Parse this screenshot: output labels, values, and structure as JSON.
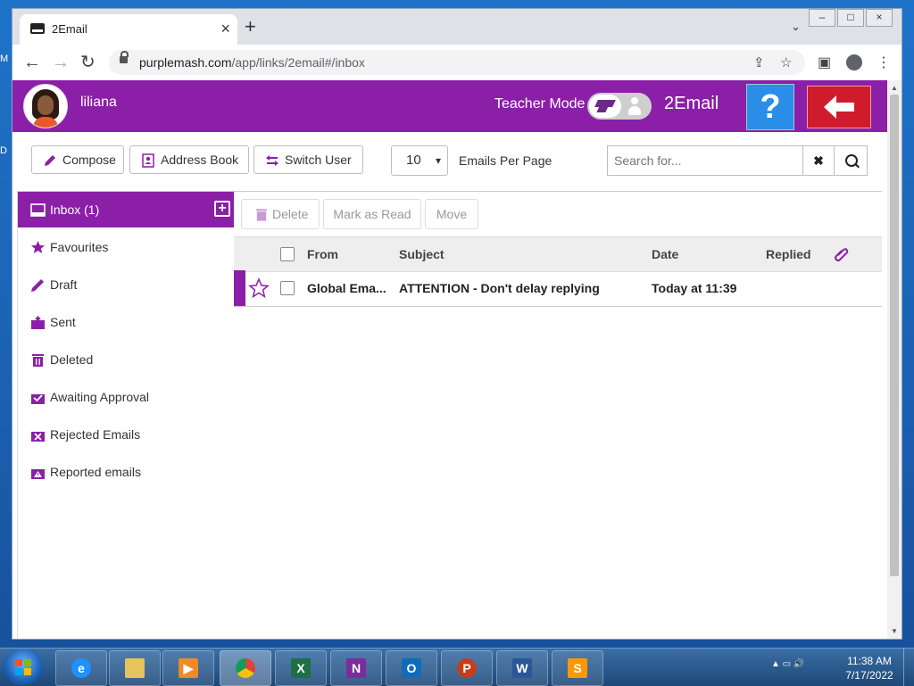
{
  "desktop": {
    "edge_top": "M",
    "edge_mid": "D"
  },
  "browser": {
    "tab_title": "2Email",
    "url_host": "purplemash.com",
    "url_path": "/app/links/2email#/inbox"
  },
  "header": {
    "username": "liliana",
    "teacher_mode_label": "Teacher Mode",
    "app_title": "2Email",
    "help_label": "?"
  },
  "toolbar": {
    "compose_label": "Compose",
    "address_book_label": "Address Book",
    "switch_user_label": "Switch User",
    "per_page_value": "10",
    "per_page_label": "Emails Per Page",
    "search_placeholder": "Search for..."
  },
  "sidebar": {
    "items": [
      {
        "label": "Inbox (1)"
      },
      {
        "label": "Favourites"
      },
      {
        "label": "Draft"
      },
      {
        "label": "Sent"
      },
      {
        "label": "Deleted"
      },
      {
        "label": "Awaiting Approval"
      },
      {
        "label": "Rejected Emails"
      },
      {
        "label": "Reported emails"
      }
    ]
  },
  "mail_actions": {
    "delete_label": "Delete",
    "mark_read_label": "Mark as Read",
    "move_label": "Move"
  },
  "columns": {
    "from": "From",
    "subject": "Subject",
    "date": "Date",
    "replied": "Replied"
  },
  "emails": [
    {
      "from": "Global Ema...",
      "subject": "ATTENTION - Don't delay replying",
      "date": "Today at 11:39",
      "replied": ""
    }
  ],
  "taskbar": {
    "time": "11:38 AM",
    "date": "7/17/2022"
  },
  "colors": {
    "brand": "#8b1fa8",
    "help_blue": "#2a8ee8",
    "back_red": "#cf1b2c"
  }
}
